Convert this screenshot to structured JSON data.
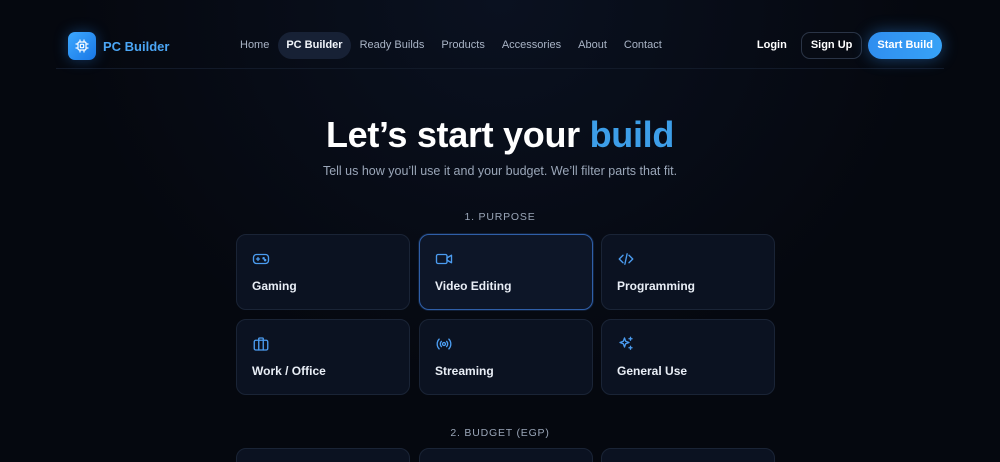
{
  "brand": {
    "name": "PC Builder",
    "icon": "cpu-chip-icon"
  },
  "nav": {
    "links": [
      {
        "label": "Home",
        "active": false
      },
      {
        "label": "PC Builder",
        "active": true
      },
      {
        "label": "Ready Builds",
        "active": false
      },
      {
        "label": "Products",
        "active": false
      },
      {
        "label": "Accessories",
        "active": false
      },
      {
        "label": "About",
        "active": false
      },
      {
        "label": "Contact",
        "active": false
      }
    ],
    "login": "Login",
    "signup": "Sign Up",
    "start": "Start Build"
  },
  "hero": {
    "title_prefix": "Let’s start your",
    "title_accent": "build",
    "subtitle": "Tell us how you’ll use it and your budget. We’ll filter parts that fit."
  },
  "purpose": {
    "label": "1. PURPOSE",
    "options": [
      {
        "label": "Gaming",
        "icon": "gamepad-icon",
        "selected": false
      },
      {
        "label": "Video Editing",
        "icon": "video-camera-icon",
        "selected": true
      },
      {
        "label": "Programming",
        "icon": "code-icon",
        "selected": false
      },
      {
        "label": "Work / Office",
        "icon": "briefcase-icon",
        "selected": false
      },
      {
        "label": "Streaming",
        "icon": "broadcast-icon",
        "selected": false
      },
      {
        "label": "General Use",
        "icon": "sparkles-icon",
        "selected": false
      }
    ]
  },
  "budget": {
    "label": "2. BUDGET (EGP)"
  },
  "colors": {
    "accent": "#3d9ee8",
    "icon": "#4b9cf0",
    "background": "#05080f",
    "card": "#0b1221"
  }
}
